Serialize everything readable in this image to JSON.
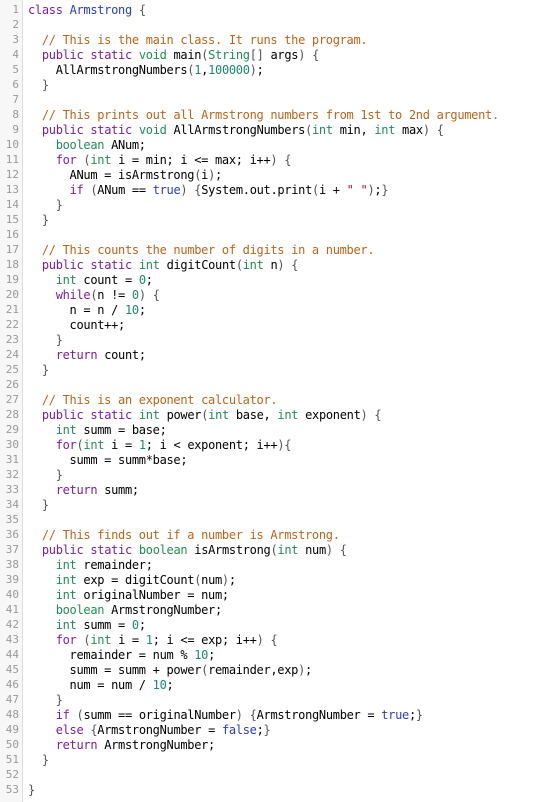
{
  "editor": {
    "lines": [
      "class Armstrong {",
      "",
      "  // This is the main class. It runs the program.",
      "  public static void main(String[] args) {",
      "    AllArmstrongNumbers(1,100000);",
      "  }",
      "",
      "  // This prints out all Armstrong numbers from 1st to 2nd argument.",
      "  public static void AllArmstrongNumbers(int min, int max) {",
      "    boolean ANum;",
      "    for (int i = min; i <= max; i++) {",
      "      ANum = isArmstrong(i);",
      "      if (ANum == true) {System.out.print(i + \" \");}",
      "    }",
      "  }",
      "",
      "  // This counts the number of digits in a number.",
      "  public static int digitCount(int n) {",
      "    int count = 0;",
      "    while(n != 0) {",
      "      n = n / 10;",
      "      count++;",
      "    }",
      "    return count;",
      "  }",
      "",
      "  // This is an exponent calculator.",
      "  public static int power(int base, int exponent) {",
      "    int summ = base;",
      "    for(int i = 1; i < exponent; i++){",
      "      summ = summ*base;",
      "    }",
      "    return summ;",
      "  }",
      "",
      "  // This finds out if a number is Armstrong.",
      "  public static boolean isArmstrong(int num) {",
      "    int remainder;",
      "    int exp = digitCount(num);",
      "    int originalNumber = num;",
      "    boolean ArmstrongNumber;",
      "    int summ = 0;",
      "    for (int i = 1; i <= exp; i++) {",
      "      remainder = num % 10;",
      "      summ = summ + power(remainder,exp);",
      "      num = num / 10;",
      "    }",
      "    if (summ == originalNumber) {ArmstrongNumber = true;}",
      "    else {ArmstrongNumber = false;}",
      "    return ArmstrongNumber;",
      "  }",
      "",
      "}"
    ]
  }
}
